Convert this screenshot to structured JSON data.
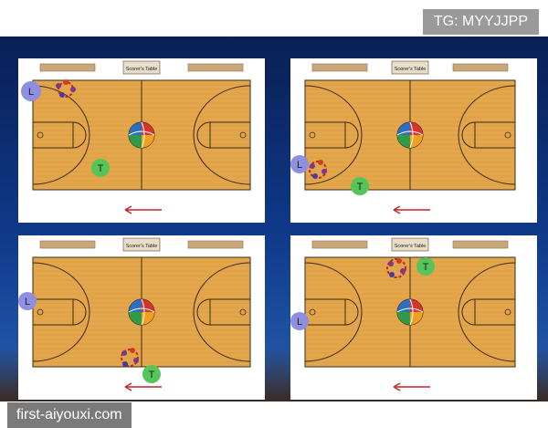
{
  "header": {
    "badge": "TG: MYYJJPP"
  },
  "footer": {
    "watermark": "first-aiyouxi.com"
  },
  "court": {
    "scorer_label": "Scorer's Table",
    "colors": {
      "wood": "#e3a64a",
      "wood_line": "#c98c35",
      "line": "#3a2a1a",
      "banner": "#c8a878",
      "marker_l": "#8e8fe0",
      "marker_t": "#57c45a",
      "arrow": "#c0272d"
    }
  },
  "players": {
    "L": "L",
    "T": "T"
  },
  "panels": [
    {
      "id": "top-left",
      "center_logo": "basketball-icon",
      "arrow": "left"
    },
    {
      "id": "top-right",
      "center_logo": "basketball-icon",
      "arrow": "left"
    },
    {
      "id": "bottom-left",
      "center_logo": "basketball-icon",
      "arrow": "left"
    },
    {
      "id": "bottom-right",
      "center_logo": "basketball-icon",
      "arrow": "left"
    }
  ]
}
